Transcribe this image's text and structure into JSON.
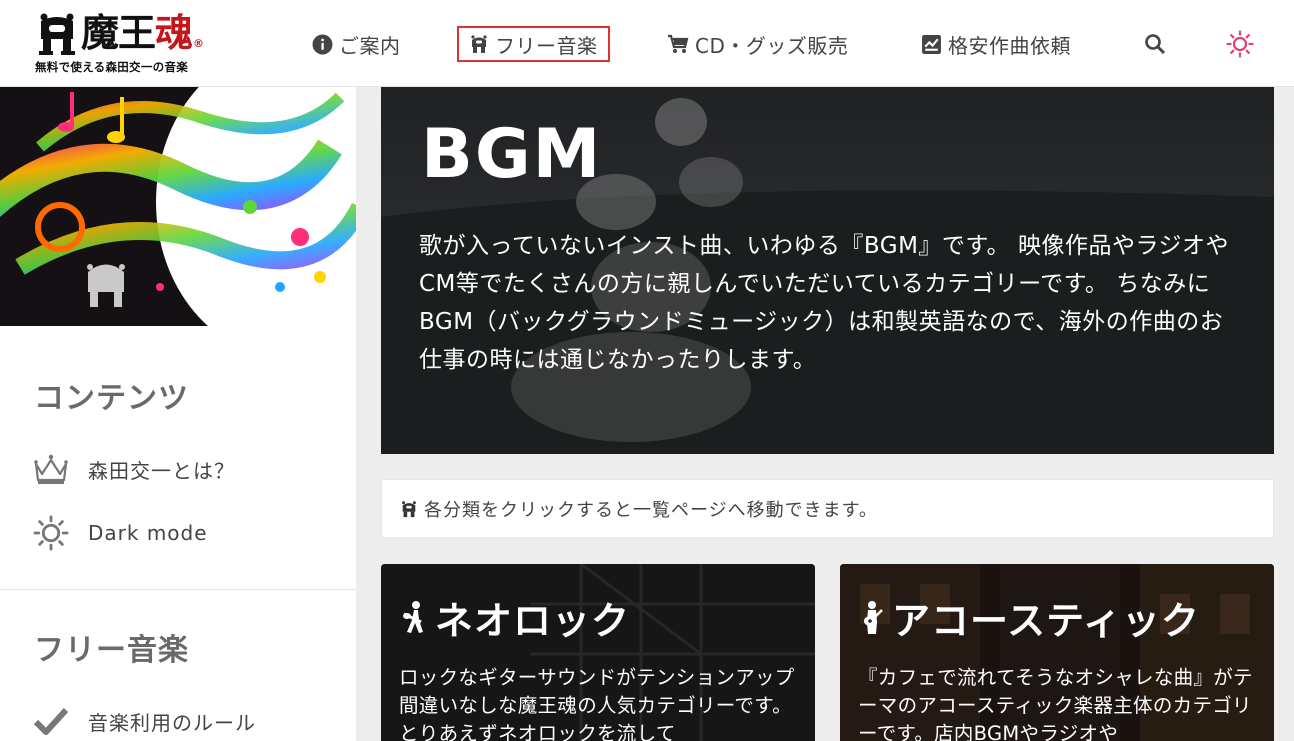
{
  "header": {
    "logo": {
      "title_part1": "魔王",
      "title_part2": "魂",
      "registered": "®",
      "subtitle": "無料で使える森田交一の音楽"
    },
    "nav": [
      {
        "label": "ご案内",
        "icon": "info-icon"
      },
      {
        "label": "フリー音楽",
        "icon": "maou-robot-icon",
        "active": true
      },
      {
        "label": "CD・グッズ販売",
        "icon": "cart-icon"
      },
      {
        "label": "格安作曲依頼",
        "icon": "chart-box-icon"
      }
    ],
    "search_icon": "search-icon",
    "theme_icon": "sun-icon"
  },
  "sidebar": {
    "sections": [
      {
        "title": "コンテンツ",
        "items": [
          {
            "label": "森田交一とは？",
            "icon": "crown-icon"
          },
          {
            "label": "Dark mode",
            "icon": "sun-icon"
          }
        ]
      },
      {
        "title": "フリー音楽",
        "items": [
          {
            "label": "音楽利用のルール",
            "icon": "check-icon"
          }
        ]
      }
    ]
  },
  "hero": {
    "title": "BGM",
    "description": "歌が入っていないインスト曲、いわゆる『BGM』です。 映像作品やラジオやCM等でたくさんの方に親しんでいただいているカテゴリーです。 ちなみにBGM（バックグラウンドミュージック）は和製英語なので、海外の作曲のお仕事の時には通じなかったりします。"
  },
  "notice": {
    "text": "各分類をクリックすると一覧ページへ移動できます。"
  },
  "cards": [
    {
      "title": "ネオロック",
      "icon": "guitarist-icon",
      "text": "ロックなギターサウンドがテンションアップ間違いなしな魔王魂の人気カテゴリーです。とりあえずネオロックを流して"
    },
    {
      "title": "アコースティック",
      "icon": "acoustic-guitarist-icon",
      "text": "『カフェで流れてそうなオシャレな曲』がテーマのアコースティック楽器主体のカテゴリーです。店内BGMやラジオや"
    }
  ],
  "colors": {
    "accent_red": "#c4171c",
    "active_border": "#dd3333",
    "sun_pink": "#e0407a"
  }
}
